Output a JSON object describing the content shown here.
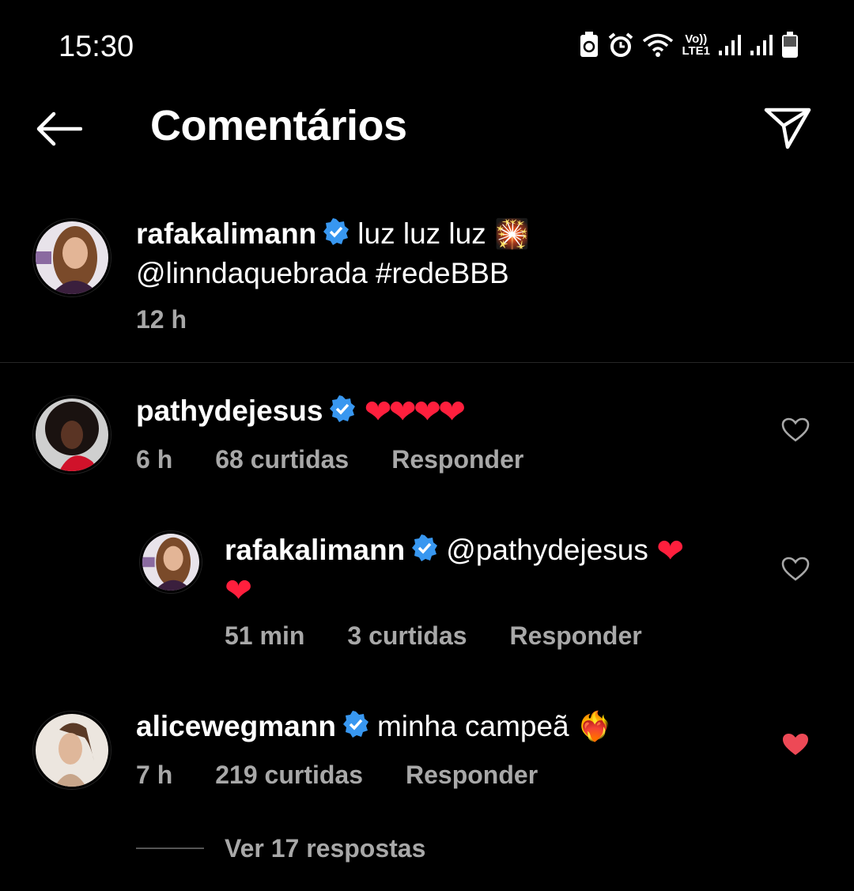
{
  "status_bar": {
    "time": "15:30",
    "network_vo": "Vo))",
    "network_lte": "LTE1"
  },
  "header": {
    "title": "Comentários"
  },
  "caption": {
    "username": "rafakalimann",
    "text_line1": "luz luz luz",
    "text_emoji": "🎇",
    "text_line2": "@linndaquebrada #redeBBB",
    "time": "12 h"
  },
  "comments": [
    {
      "username": "pathydejesus",
      "text": "❤❤❤❤",
      "time": "6 h",
      "likes": "68 curtidas",
      "reply_label": "Responder",
      "liked": false
    },
    {
      "username": "rafakalimann",
      "text": "@pathydejesus",
      "text_emoji": "❤",
      "text_line2": "❤",
      "time": "51 min",
      "likes": "3 curtidas",
      "reply_label": "Responder",
      "liked": false
    },
    {
      "username": "alicewegmann",
      "text": "minha campeã",
      "text_emoji": "❤️‍🔥",
      "time": "7 h",
      "likes": "219 curtidas",
      "reply_label": "Responder",
      "liked": true
    }
  ],
  "view_replies": "Ver 17 respostas",
  "colors": {
    "background": "#000000",
    "muted_text": "#a8a8a8",
    "verified": "#3897f0",
    "like_red": "#ed4956"
  }
}
